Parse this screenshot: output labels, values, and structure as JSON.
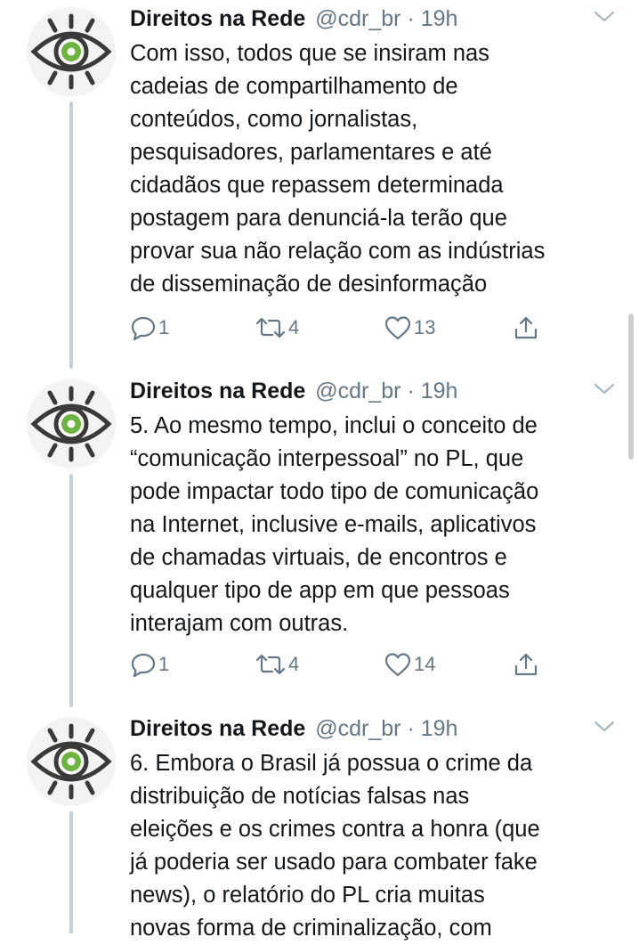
{
  "tweets": [
    {
      "author": {
        "name": "Direitos na Rede",
        "handle": "@cdr_br",
        "separator": "·",
        "time": "19h"
      },
      "lines": [
        "Com isso, todos que se insiram nas",
        "cadeias de compartilhamento de",
        "conteúdos, como jornalistas,",
        "pesquisadores, parlamentares e até",
        "cidadãos que repassem determinada",
        "postagem para denunciá-la terão que",
        "provar sua não relação com as indústrias",
        "de disseminação de desinformação"
      ],
      "actions": {
        "replies": "1",
        "retweets": "4",
        "likes": "13"
      }
    },
    {
      "author": {
        "name": "Direitos na Rede",
        "handle": "@cdr_br",
        "separator": "·",
        "time": "19h"
      },
      "lines": [
        "5. Ao mesmo tempo, inclui o conceito de",
        "“comunicação interpessoal” no PL, que",
        "pode impactar todo tipo de comunicação",
        "na Internet, inclusive e-mails, aplicativos",
        "de chamadas virtuais, de encontros e",
        "qualquer tipo de app em que pessoas",
        "interajam com outras."
      ],
      "actions": {
        "replies": "1",
        "retweets": "4",
        "likes": "14"
      }
    },
    {
      "author": {
        "name": "Direitos na Rede",
        "handle": "@cdr_br",
        "separator": "·",
        "time": "19h"
      },
      "lines": [
        "6. Embora o Brasil já possua o crime da",
        "distribuição de notícias falsas nas",
        "eleições e os crimes contra a honra (que",
        "já poderia ser usado para combater fake",
        "news), o relatório do PL cria muitas",
        "novas forma de criminalização, com"
      ]
    }
  ],
  "icons": {
    "avatar": "eye-logo-icon",
    "menu": "chevron-down-icon",
    "reply": "reply-icon",
    "retweet": "retweet-icon",
    "like": "heart-icon",
    "share": "share-icon"
  },
  "colors": {
    "text": "#14171a",
    "secondary": "#657786",
    "thread_line": "#c6ced6",
    "avatar_iris": "#6db33f"
  }
}
